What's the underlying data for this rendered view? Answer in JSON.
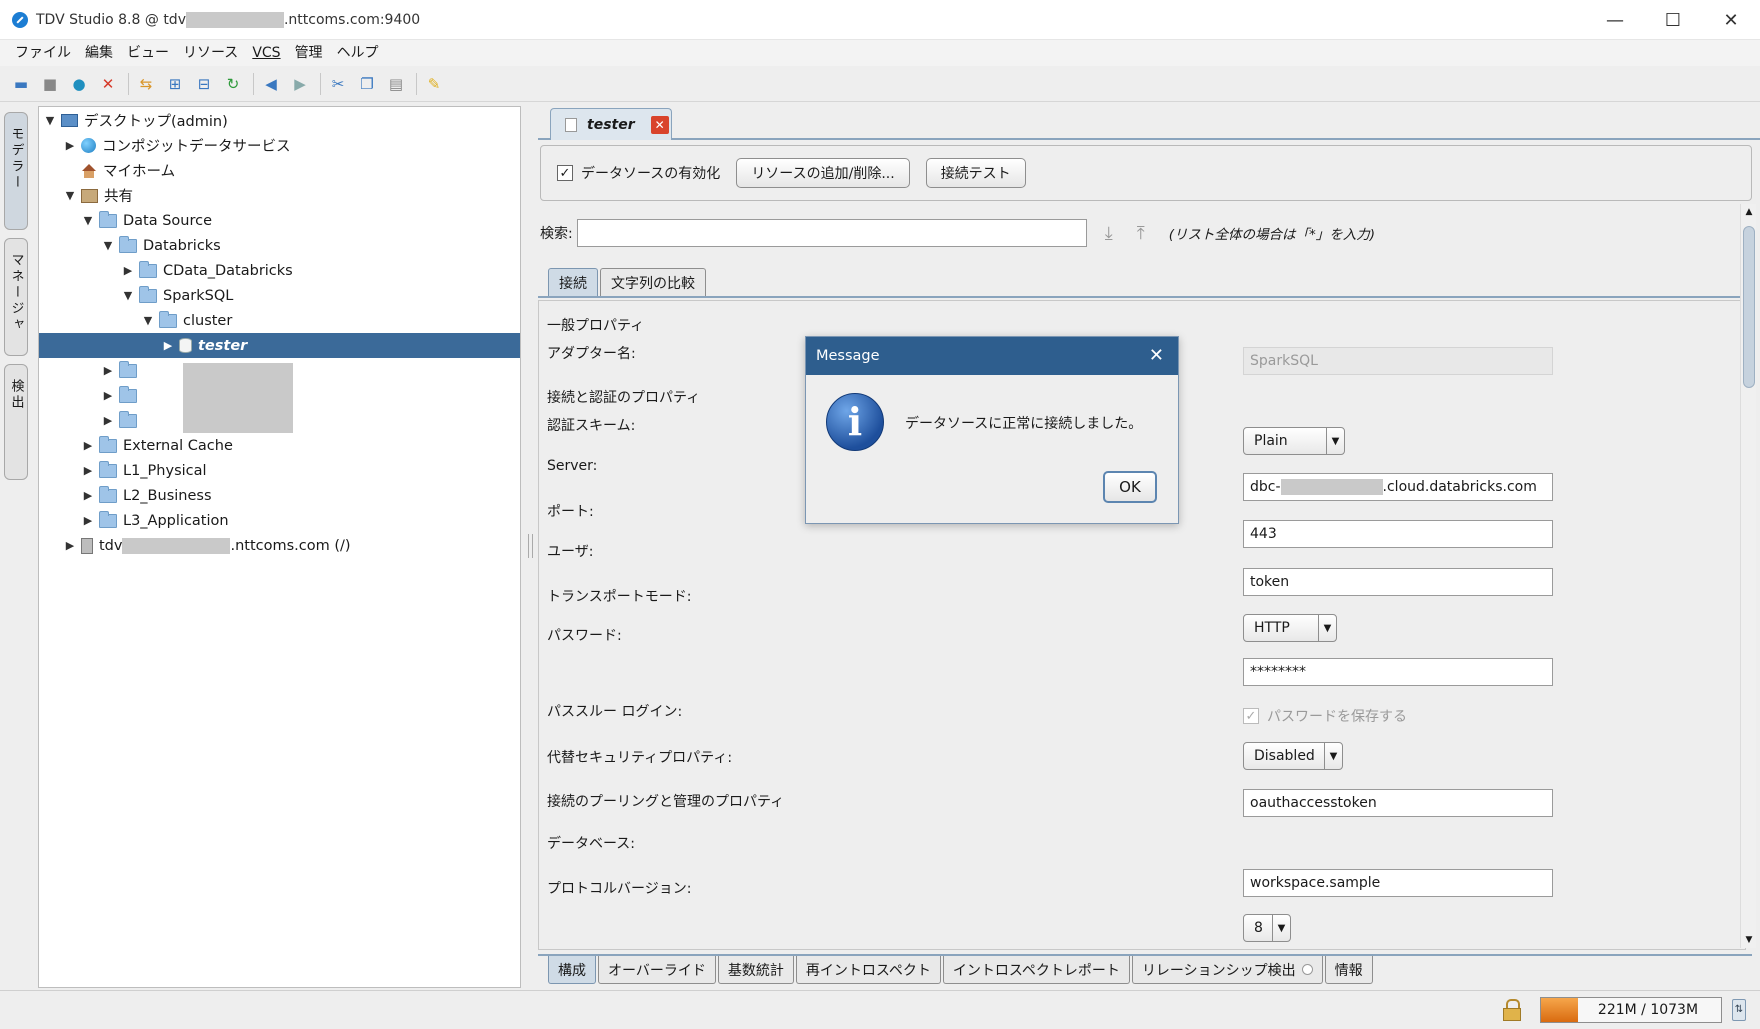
{
  "window": {
    "title_prefix": "TDV Studio 8.8 @ tdv",
    "title_suffix": ".nttcoms.com:9400",
    "minimize": "—",
    "maximize": "☐",
    "close": "✕"
  },
  "menu": [
    "ファイル",
    "編集",
    "ビュー",
    "リソース",
    "VCS",
    "管理",
    "ヘルプ"
  ],
  "toolbar_icons": [
    "open-folder-icon",
    "save-icon",
    "publish-icon",
    "delete-icon",
    "refresh-icon",
    "expand-icon",
    "collapse-icon",
    "sync-icon",
    "back-icon",
    "forward-icon",
    "cut-icon",
    "copy-icon",
    "paste-icon",
    "note-icon"
  ],
  "side_tabs": [
    "モデラー",
    "マネージャ",
    "検出"
  ],
  "tree": {
    "desktop": "デスクトップ(admin)",
    "composite": "コンポジットデータサービス",
    "myhome": "マイホーム",
    "shared": "共有",
    "datasource": "Data Source",
    "databricks": "Databricks",
    "cdata": "CData_Databricks",
    "sparksql": "SparkSQL",
    "cluster": "cluster",
    "tester": "tester",
    "external_cache": "External Cache",
    "l1": "L1_Physical",
    "l2": "L2_Business",
    "l3": "L3_Application",
    "server_prefix": "tdv",
    "server_suffix": ".nttcoms.com (/)"
  },
  "editor": {
    "tab_label": "tester",
    "enable_label": "データソースの有効化",
    "add_remove_button": "リソースの追加/削除...",
    "test_button": "接続テスト",
    "search_label": "検索:",
    "search_value": "",
    "search_hint": "(リスト全体の場合は「*」を入力)",
    "sub_tabs": [
      "接続",
      "文字列の比較"
    ],
    "bottom_tabs": [
      "構成",
      "オーバーライド",
      "基数統計",
      "再イントロスペクト",
      "イントロスペクトレポート",
      "リレーションシップ検出",
      "情報"
    ]
  },
  "props": {
    "general_header": "一般プロパティ",
    "adapter_label": "アダプター名:",
    "adapter_value": "SparkSQL",
    "auth_header": "接続と認証のプロパティ",
    "auth_scheme_label": "認証スキーム:",
    "auth_scheme_value": "Plain",
    "server_label": "Server:",
    "server_prefix": "dbc-",
    "server_suffix": ".cloud.databricks.com",
    "port_label": "ポート:",
    "port_value": "443",
    "user_label": "ユーザ:",
    "user_value": "token",
    "transport_label": "トランスポートモード:",
    "transport_value": "HTTP",
    "password_label": "パスワード:",
    "password_value": "********",
    "save_password_label": "パスワードを保存する",
    "passthrough_label": "パススルー ログイン:",
    "passthrough_value": "Disabled",
    "alt_security_label": "代替セキュリティプロパティ:",
    "alt_security_value": "oauthaccesstoken",
    "pooling_header": "接続のプーリングと管理のプロパティ",
    "database_label": "データベース:",
    "database_value": "workspace.sample",
    "protocol_label": "プロトコルバージョン:",
    "protocol_value": "8"
  },
  "status": {
    "memory": "221M / 1073M",
    "memory_used_fraction": 0.206
  },
  "dialog": {
    "title": "Message",
    "message": "データソースに正常に接続しました。",
    "ok": "OK"
  }
}
